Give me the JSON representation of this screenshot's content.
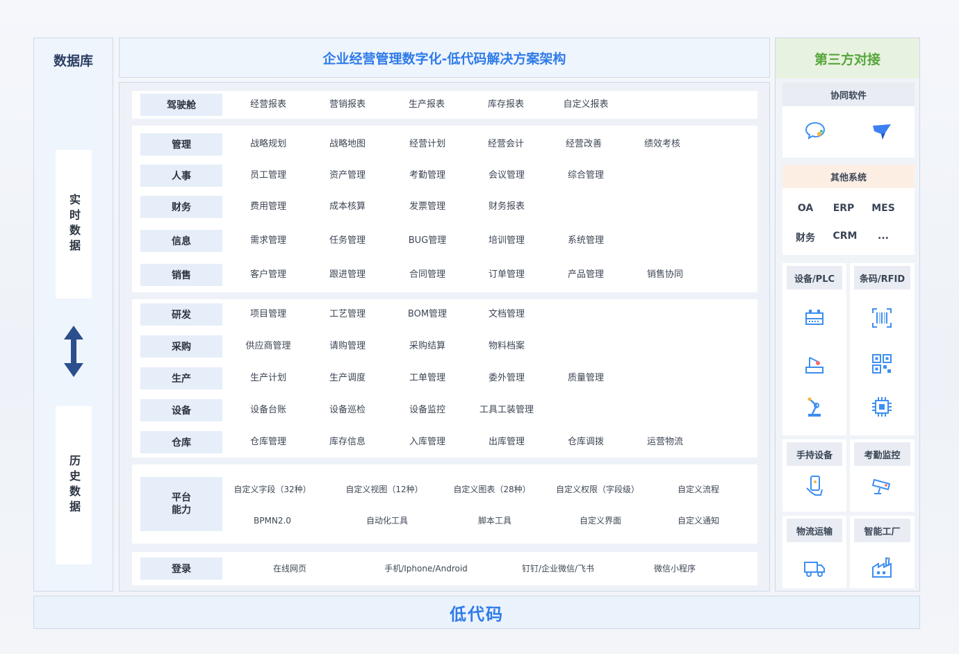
{
  "database": {
    "title": "数据库",
    "realtime": "实时数据",
    "history": "历史数据",
    "arrow_icon": "double-arrow-vertical-icon"
  },
  "main": {
    "title": "企业经营管理数字化-低代码解决方案架构",
    "cockpit": {
      "label": "驾驶舱",
      "items": [
        "经营报表",
        "营销报表",
        "生产报表",
        "库存报表",
        "自定义报表"
      ]
    },
    "group1": [
      {
        "label": "管理",
        "items": [
          "战略规划",
          "战略地图",
          "经营计划",
          "经营会计",
          "经营改善",
          "绩效考核"
        ]
      },
      {
        "label": "人事",
        "items": [
          "员工管理",
          "资产管理",
          "考勤管理",
          "会议管理",
          "综合管理"
        ]
      },
      {
        "label": "财务",
        "items": [
          "费用管理",
          "成本核算",
          "发票管理",
          "财务报表"
        ]
      },
      {
        "label": "信息",
        "items": [
          "需求管理",
          "任务管理",
          "BUG管理",
          "培训管理",
          "系统管理"
        ]
      },
      {
        "label": "销售",
        "items": [
          "客户管理",
          "跟进管理",
          "合同管理",
          "订单管理",
          "产品管理",
          "销售协同"
        ]
      }
    ],
    "group2": [
      {
        "label": "研发",
        "items": [
          "项目管理",
          "工艺管理",
          "BOM管理",
          "文档管理"
        ]
      },
      {
        "label": "采购",
        "items": [
          "供应商管理",
          "请购管理",
          "采购结算",
          "物料档案"
        ]
      },
      {
        "label": "生产",
        "items": [
          "生产计划",
          "生产调度",
          "工单管理",
          "委外管理",
          "质量管理"
        ]
      },
      {
        "label": "设备",
        "items": [
          "设备台账",
          "设备巡检",
          "设备监控",
          "工具工装管理"
        ]
      },
      {
        "label": "仓库",
        "items": [
          "仓库管理",
          "库存信息",
          "入库管理",
          "出库管理",
          "仓库调拨",
          "运营物流"
        ]
      }
    ],
    "platform": {
      "label_line1": "平台",
      "label_line2": "能力",
      "row1": [
        "自定义字段（32种）",
        "自定义视图（12种）",
        "自定义图表（28种）",
        "自定义权限（字段级）",
        "自定义流程"
      ],
      "row2": [
        "BPMN2.0",
        "自动化工具",
        "脚本工具",
        "自定义界面",
        "自定义通知"
      ]
    },
    "login": {
      "label": "登录",
      "items": [
        "在线网页",
        "手机/Iphone/Android",
        "钉钉/企业微信/飞书",
        "微信小程序"
      ]
    }
  },
  "third_party": {
    "title": "第三方对接",
    "collab": {
      "label": "协同软件",
      "icons": [
        "chat-bubble-icon",
        "feishu-bird-icon"
      ]
    },
    "other": {
      "label": "其他系统",
      "items": [
        "OA",
        "ERP",
        "MES",
        "财务",
        "CRM",
        "..."
      ]
    },
    "plc": {
      "label": "设备/PLC",
      "icons": [
        "plc-controller-icon",
        "robot-arm-station-icon",
        "robot-arm-icon"
      ]
    },
    "rfid": {
      "label": "条码/RFID",
      "icons": [
        "barcode-scan-icon",
        "qr-code-icon",
        "chip-icon"
      ]
    },
    "handheld": {
      "label": "手持设备",
      "icon": "handheld-phone-icon"
    },
    "attendance": {
      "label": "考勤监控",
      "icon": "security-camera-icon"
    },
    "logistics": {
      "label": "物流运输",
      "icon": "truck-icon"
    },
    "factory": {
      "label": "智能工厂",
      "icon": "factory-icon"
    }
  },
  "footer": {
    "title": "低代码"
  },
  "colors": {
    "accent_blue": "#2f7be8",
    "accent_green": "#55a63b",
    "category_bg": "#e6eef9"
  }
}
